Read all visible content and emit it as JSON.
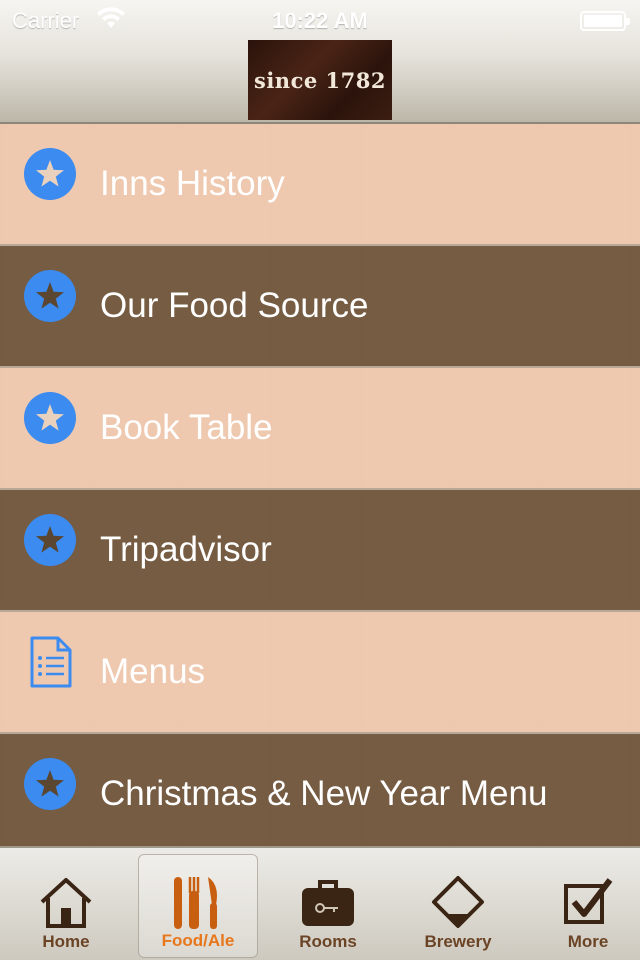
{
  "status_bar": {
    "carrier": "Carrier",
    "time": "10:22 AM",
    "wifi_icon": "wifi-icon",
    "battery_icon": "battery-icon"
  },
  "header": {
    "logo_text": "since 1782"
  },
  "menu": {
    "items": [
      {
        "label": "Inns History",
        "icon": "star-icon",
        "style": "light"
      },
      {
        "label": "Our Food Source",
        "icon": "star-icon",
        "style": "dark"
      },
      {
        "label": "Book Table",
        "icon": "star-icon",
        "style": "light"
      },
      {
        "label": "Tripadvisor",
        "icon": "star-icon",
        "style": "dark"
      },
      {
        "label": "Menus",
        "icon": "document-list-icon",
        "style": "light"
      },
      {
        "label": "Christmas & New Year Menu",
        "icon": "star-icon",
        "style": "dark"
      }
    ]
  },
  "tabbar": {
    "tabs": [
      {
        "label": "Home",
        "icon": "house-icon",
        "active": false
      },
      {
        "label": "Food/Ale",
        "icon": "fork-knife-icon",
        "active": true
      },
      {
        "label": "Rooms",
        "icon": "briefcase-key-icon",
        "active": false
      },
      {
        "label": "Brewery",
        "icon": "beaker-icon",
        "active": false
      },
      {
        "label": "More",
        "icon": "checkbox-icon",
        "active": false
      }
    ]
  },
  "colors": {
    "star_blue": "#3b8bf0",
    "tab_brown": "#6b4426",
    "tab_active_orange": "#e8771c",
    "row_light": "#f4cdb4",
    "row_dark": "#685037"
  }
}
